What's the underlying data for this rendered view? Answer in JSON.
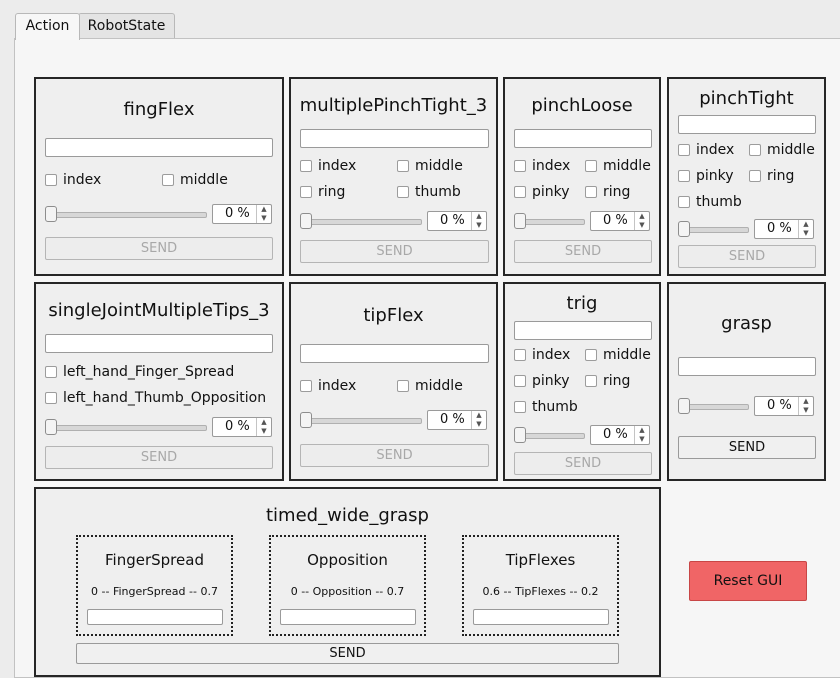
{
  "tabs": [
    {
      "label": "Action",
      "active": true
    },
    {
      "label": "RobotState",
      "active": false
    }
  ],
  "groups": {
    "fingFlex": {
      "title": "fingFlex",
      "checkboxes": [
        "index",
        "middle"
      ],
      "percent": "0 %",
      "send": "SEND"
    },
    "multiplePinchTight_3": {
      "title": "multiplePinchTight_3",
      "checkboxes": [
        "index",
        "middle",
        "ring",
        "thumb"
      ],
      "percent": "0 %",
      "send": "SEND"
    },
    "pinchLoose": {
      "title": "pinchLoose",
      "checkboxes": [
        "index",
        "middle",
        "pinky",
        "ring"
      ],
      "percent": "0 %",
      "send": "SEND"
    },
    "pinchTight": {
      "title": "pinchTight",
      "checkboxes": [
        "index",
        "middle",
        "pinky",
        "ring",
        "thumb"
      ],
      "percent": "0 %",
      "send": "SEND"
    },
    "singleJointMultipleTips_3": {
      "title": "singleJointMultipleTips_3",
      "checkboxes": [
        "left_hand_Finger_Spread",
        "left_hand_Thumb_Opposition"
      ],
      "percent": "0 %",
      "send": "SEND"
    },
    "tipFlex": {
      "title": "tipFlex",
      "checkboxes": [
        "index",
        "middle"
      ],
      "percent": "0 %",
      "send": "SEND"
    },
    "trig": {
      "title": "trig",
      "checkboxes": [
        "index",
        "middle",
        "pinky",
        "ring",
        "thumb"
      ],
      "percent": "0 %",
      "send": "SEND"
    },
    "grasp": {
      "title": "grasp",
      "percent": "0 %",
      "send": "SEND"
    }
  },
  "timed_wide_grasp": {
    "title": "timed_wide_grasp",
    "subgroups": [
      {
        "title": "FingerSpread",
        "range": "0 -- FingerSpread -- 0.7"
      },
      {
        "title": "Opposition",
        "range": "0 -- Opposition -- 0.7"
      },
      {
        "title": "TipFlexes",
        "range": "0.6 -- TipFlexes -- 0.2"
      }
    ],
    "send": "SEND"
  },
  "reset_label": "Reset GUI",
  "colors": {
    "reset_bg": "#f06566",
    "group_border": "#262626"
  },
  "icons": {
    "spin_arrows": "up-down-arrows-icon"
  }
}
